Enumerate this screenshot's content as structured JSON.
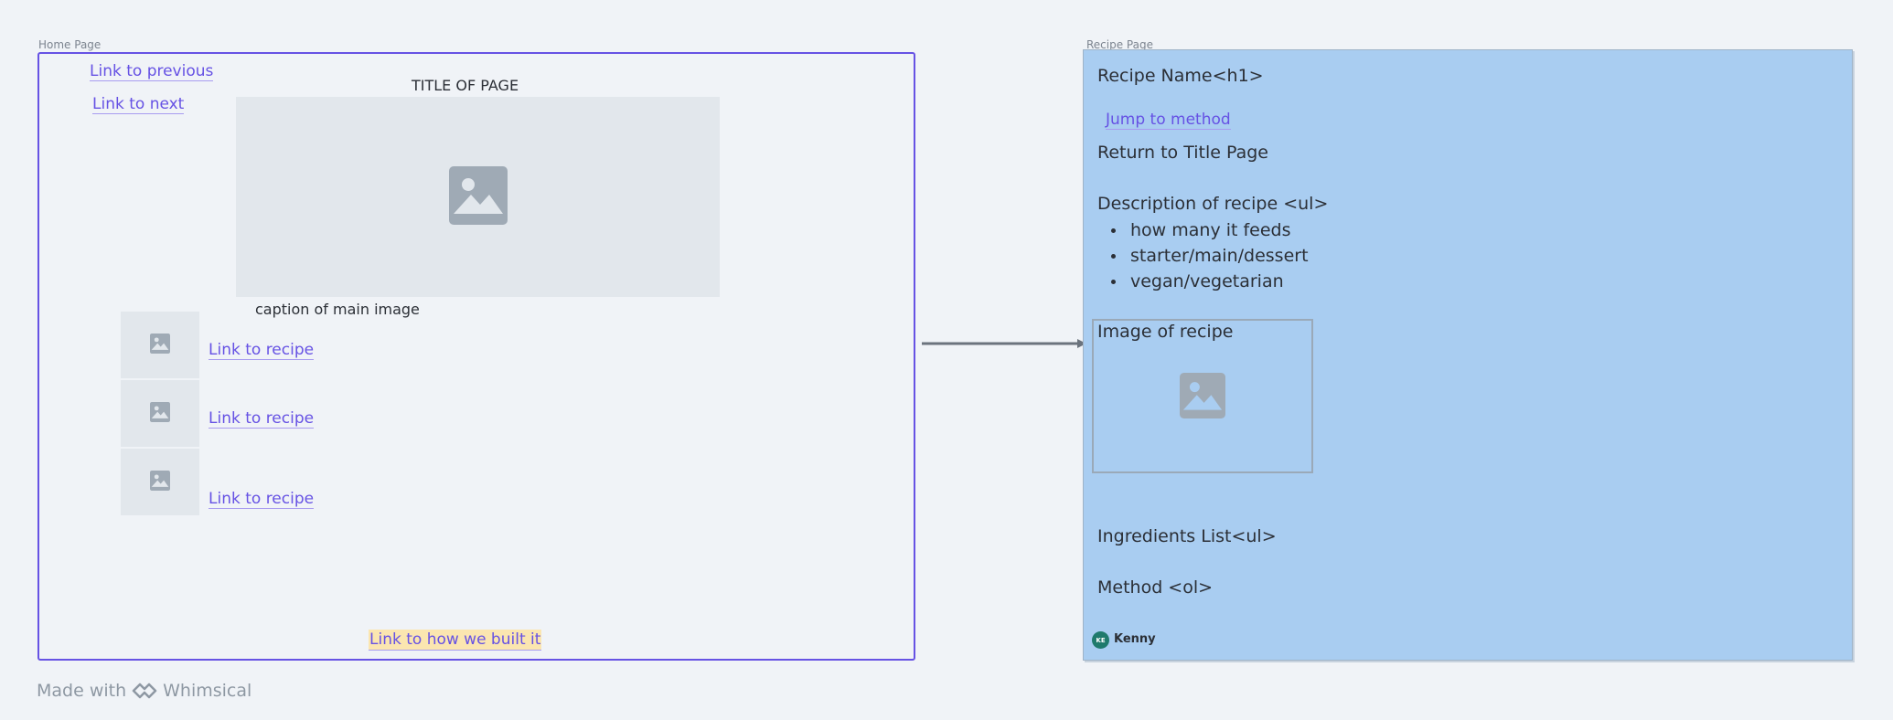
{
  "home_frame": {
    "label": "Home Page",
    "link_previous": "Link to previous",
    "link_next": "Link to next",
    "title": "TITLE OF PAGE",
    "main_image_icon": "image-icon",
    "caption": "caption of main image",
    "recipe_links": [
      {
        "label": "Link to recipe",
        "icon": "image-icon"
      },
      {
        "label": "Link to recipe",
        "icon": "image-icon"
      },
      {
        "label": "Link to recipe",
        "icon": "image-icon"
      }
    ],
    "built_link": "Link to how we built it",
    "border_color": "#6652e4"
  },
  "connector": {
    "color": "#6b737d"
  },
  "recipe_frame": {
    "label": "Recipe Page",
    "background": "#a9cdf1",
    "recipe_name": "Recipe Name<h1>",
    "jump_link": "Jump to method",
    "return_text": "Return to Title Page",
    "description_heading": "Description of recipe <ul>",
    "description_items": [
      "how many it feeds",
      "starter/main/dessert",
      "vegan/vegetarian"
    ],
    "image_label": "Image of recipe",
    "image_icon": "image-icon",
    "ingredients": "Ingredients List<ul>",
    "method": "Method <ol>",
    "author_initials": "KE",
    "author_name": "Kenny"
  },
  "footer": {
    "made_with": "Made with",
    "brand": "Whimsical",
    "brand_icon": "whimsical-logo-icon"
  }
}
